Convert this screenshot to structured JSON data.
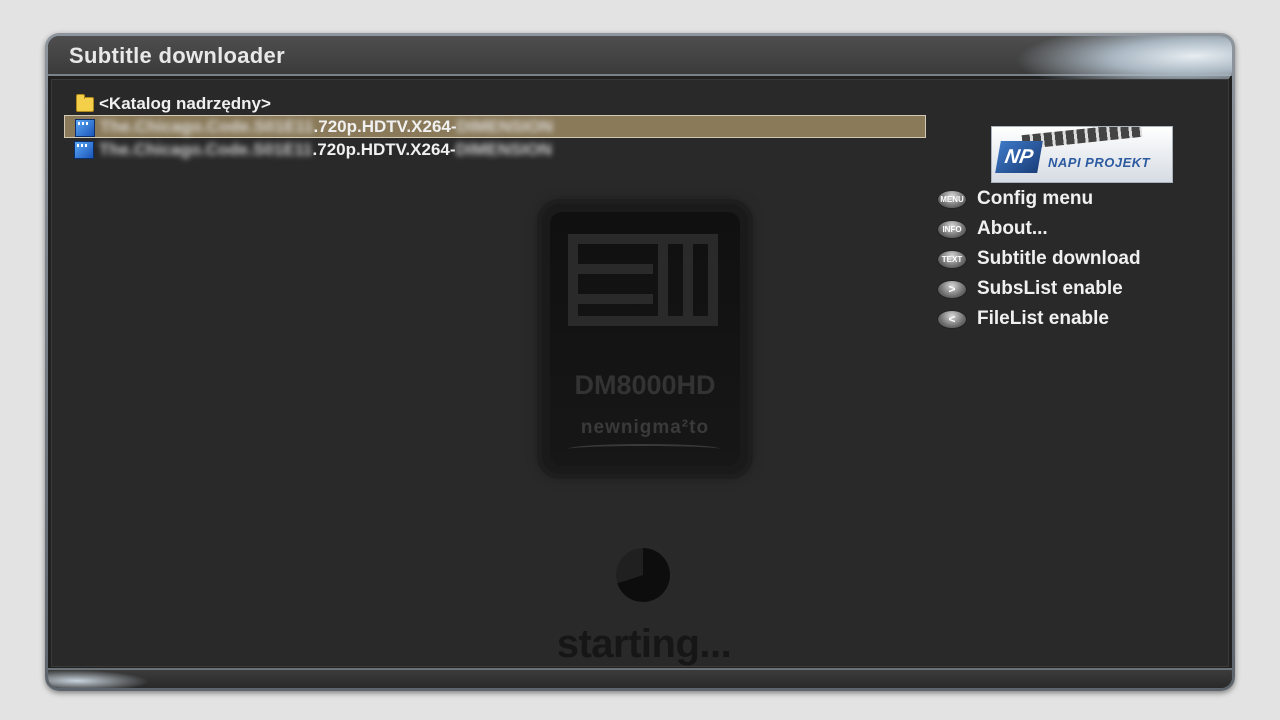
{
  "window": {
    "title": "Subtitle downloader"
  },
  "filelist": {
    "parent_folder": "<Katalog nadrzędny>",
    "files": [
      {
        "prefix": "The.Chicago.Code.S01E11",
        "visible": ".720p.HDTV.X264-",
        "suffix": "DIMENSION",
        "selected": true
      },
      {
        "prefix": "The.Chicago.Code.S01E11",
        "visible": ".720p.HDTV.X264-",
        "suffix": "DIMENSION",
        "selected": false
      }
    ]
  },
  "logo": {
    "badge": "NP",
    "name": "NAPI PROJEKT"
  },
  "menu": [
    {
      "key": "MENU",
      "icon": "menu-button-icon",
      "label": "Config menu"
    },
    {
      "key": "INFO",
      "icon": "info-button-icon",
      "label": "About..."
    },
    {
      "key": "TEXT",
      "icon": "text-button-icon",
      "label": "Subtitle download"
    },
    {
      "key": ">",
      "icon": "next-button-icon",
      "label": "SubsList enable"
    },
    {
      "key": "<",
      "icon": "prev-button-icon",
      "label": "FileList enable"
    }
  ],
  "watermark": {
    "model": "DM8000HD",
    "brand": "newnigma²to"
  },
  "status": {
    "text": "starting..."
  }
}
